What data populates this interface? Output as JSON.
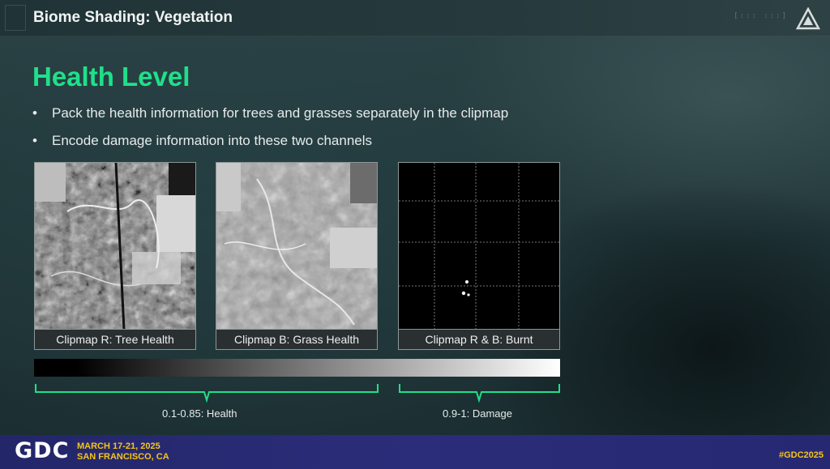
{
  "header": {
    "title": "Biome Shading: Vegetation"
  },
  "section": {
    "title": "Health Level"
  },
  "bullets": [
    "Pack the health information for trees and grasses separately in the clipmap",
    "Encode damage information into these two channels"
  ],
  "bullet_glyph": "•",
  "maps": [
    {
      "caption": "Clipmap R:  Tree Health"
    },
    {
      "caption": "Clipmap B:   Grass Health"
    },
    {
      "caption": "Clipmap R & B:  Burnt"
    }
  ],
  "legend": {
    "health_label": "0.1-0.85: Health",
    "damage_label": "0.9-1: Damage"
  },
  "footer": {
    "logo_text": "GDC",
    "date_line1": "MARCH 17-21, 2025",
    "date_line2": "SAN FRANCISCO, CA",
    "hashtag": "#GDC2025"
  },
  "colors": {
    "accent_green": "#1fe08a",
    "footer_blue": "#2b2d7a",
    "footer_yellow": "#f5c518"
  }
}
